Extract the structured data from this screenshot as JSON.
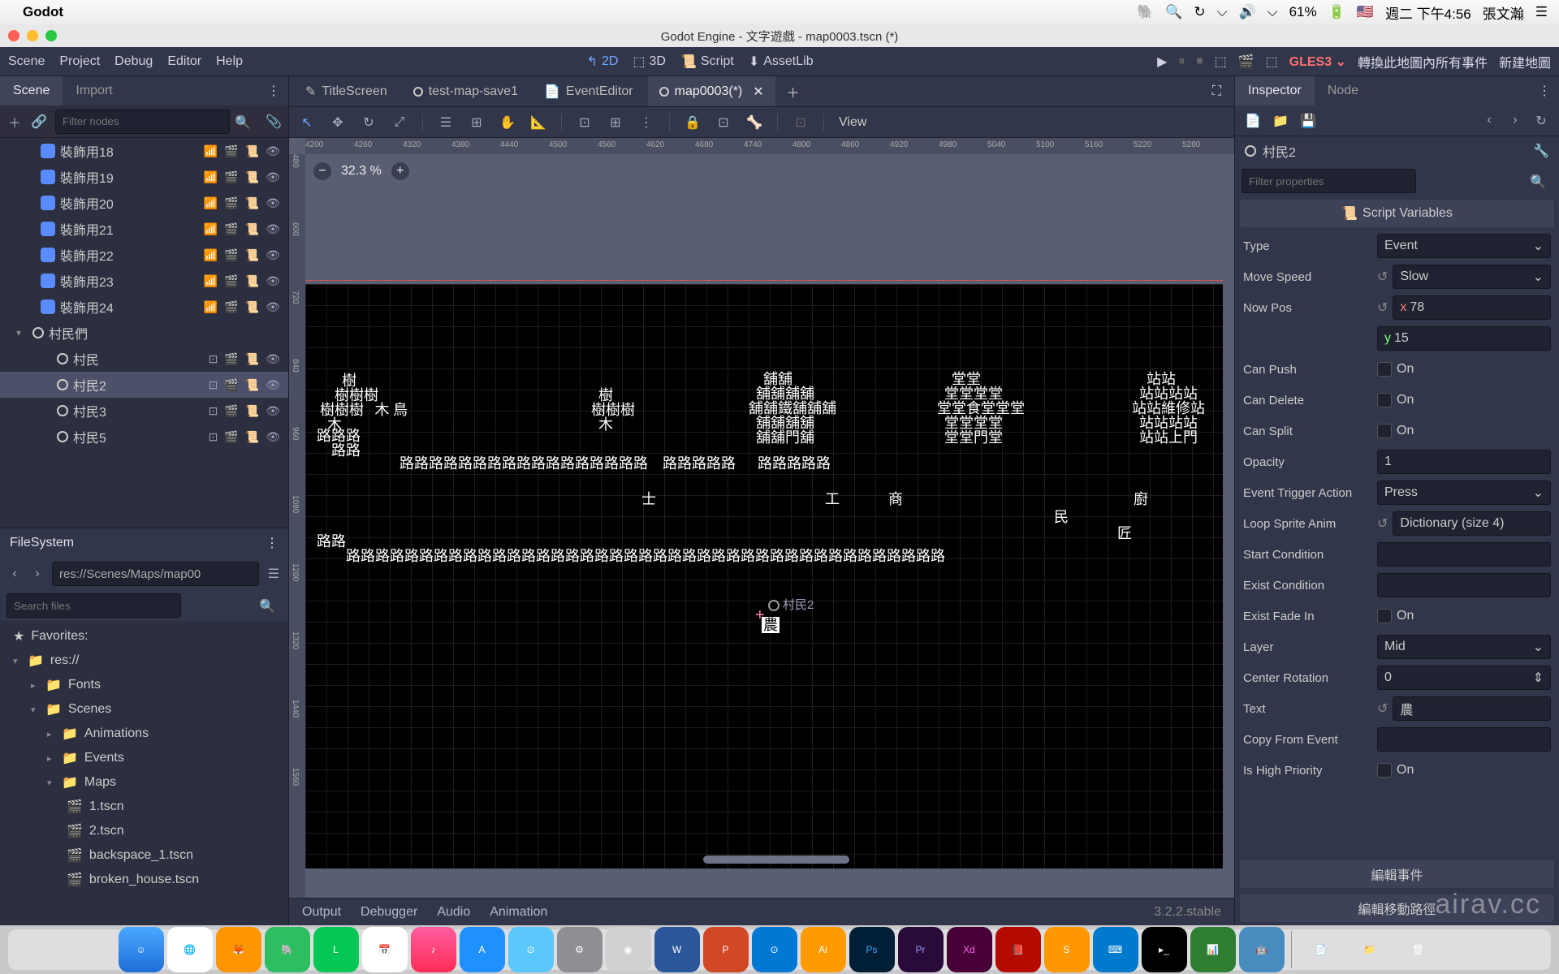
{
  "mac": {
    "app": "Godot",
    "battery": "61%",
    "flag": "🇺🇸",
    "date": "週二 下午4:56",
    "user": "張文瀚"
  },
  "window": {
    "title": "Godot Engine - 文字遊戲 - map0003.tscn (*)"
  },
  "mainmenu": {
    "scene": "Scene",
    "project": "Project",
    "debug": "Debug",
    "editor": "Editor",
    "help": "Help",
    "mode_2d": "2D",
    "mode_3d": "3D",
    "mode_script": "Script",
    "mode_assetlib": "AssetLib",
    "gles3": "GLES3",
    "cn1": "轉換此地圖內所有事件",
    "cn2": "新建地圖"
  },
  "scene_panel": {
    "tab_scene": "Scene",
    "tab_import": "Import",
    "filter_placeholder": "Filter nodes",
    "nodes": [
      {
        "name": "裝飾用18",
        "type": "blue"
      },
      {
        "name": "裝飾用19",
        "type": "blue"
      },
      {
        "name": "裝飾用20",
        "type": "blue"
      },
      {
        "name": "裝飾用21",
        "type": "blue"
      },
      {
        "name": "裝飾用22",
        "type": "blue"
      },
      {
        "name": "裝飾用23",
        "type": "blue"
      },
      {
        "name": "裝飾用24",
        "type": "blue"
      }
    ],
    "parent": "村民們",
    "children": [
      {
        "name": "村民"
      },
      {
        "name": "村民2",
        "selected": true
      },
      {
        "name": "村民3"
      },
      {
        "name": "村民5"
      }
    ]
  },
  "filesystem": {
    "title": "FileSystem",
    "path": "res://Scenes/Maps/map00",
    "search_placeholder": "Search files",
    "favorites": "Favorites:",
    "root": "res://",
    "folders": [
      "Fonts",
      "Scenes"
    ],
    "scenes_children": [
      "Animations",
      "Events",
      "Maps"
    ],
    "maps_files": [
      "1.tscn",
      "2.tscn",
      "backspace_1.tscn",
      "broken_house.tscn"
    ]
  },
  "open_tabs": [
    {
      "icon": "edit",
      "label": "TitleScreen"
    },
    {
      "icon": "circle",
      "label": "test-map-save1"
    },
    {
      "icon": "file",
      "label": "EventEditor"
    },
    {
      "icon": "circle",
      "label": "map0003(*)",
      "active": true,
      "closable": true
    }
  ],
  "viewport": {
    "view_menu": "View",
    "zoom": "32.3 %",
    "ruler_h": [
      "4200",
      "4260",
      "4320",
      "4380",
      "4440",
      "4500",
      "4560",
      "4620",
      "4680",
      "4740",
      "4800",
      "4860",
      "4920",
      "4980",
      "5040",
      "5100",
      "5160",
      "5220",
      "5280"
    ],
    "ruler_v": [
      "480",
      "600",
      "720",
      "840",
      "960",
      "1080",
      "1200",
      "1320",
      "1440",
      "1560"
    ],
    "selected_label": "村民2",
    "selected_char": "農",
    "map_text": {
      "trees1": "      樹\n    樹樹樹\n樹樹樹   木\n  木",
      "trees2": "  樹\n樹樹樹\n  木",
      "bird": "鳥",
      "shop": "    舖舖\n  舖舖舖舖\n舖舖鐵舖舖舖\n  舖舖舖舖\n  舖舖門舖",
      "hall": "    堂堂\n  堂堂堂堂\n堂堂食堂堂堂\n  堂堂堂堂\n  堂堂門堂",
      "station": "    站站\n  站站站站\n站站維修站\n  站站站站\n  站站上門",
      "road1": "路路路\n    路路",
      "road2": "路路路路路路路路路路路路路路路路路    路路路路路      路路路路路",
      "road3": "路路",
      "road4": "路路路路路路路路路路路路路路路路路路路路路路路路路路路路路路路路路路路路路路路路路",
      "shi": "士",
      "gong": "工",
      "shang": "商",
      "min": "民",
      "chu": "廚",
      "jiang": "匠"
    }
  },
  "bottom": {
    "output": "Output",
    "debugger": "Debugger",
    "audio": "Audio",
    "animation": "Animation",
    "version": "3.2.2.stable"
  },
  "inspector": {
    "tab_inspector": "Inspector",
    "tab_node": "Node",
    "node_name": "村民2",
    "filter_placeholder": "Filter properties",
    "section": "Script Variables",
    "props": {
      "type": {
        "label": "Type",
        "value": "Event"
      },
      "move_speed": {
        "label": "Move Speed",
        "value": "Slow"
      },
      "now_pos": {
        "label": "Now Pos",
        "x": "78",
        "y": "15"
      },
      "can_push": {
        "label": "Can Push",
        "value": "On"
      },
      "can_delete": {
        "label": "Can Delete",
        "value": "On"
      },
      "can_split": {
        "label": "Can Split",
        "value": "On"
      },
      "opacity": {
        "label": "Opacity",
        "value": "1"
      },
      "event_trigger": {
        "label": "Event Trigger Action",
        "value": "Press"
      },
      "loop_sprite": {
        "label": "Loop Sprite Anim",
        "value": "Dictionary (size 4)"
      },
      "start_cond": {
        "label": "Start Condition"
      },
      "exist_cond": {
        "label": "Exist Condition"
      },
      "exist_fade": {
        "label": "Exist Fade In",
        "value": "On"
      },
      "layer": {
        "label": "Layer",
        "value": "Mid"
      },
      "center_rot": {
        "label": "Center Rotation",
        "value": "0"
      },
      "text": {
        "label": "Text",
        "value": "農"
      },
      "copy_from": {
        "label": "Copy From Event"
      },
      "high_prio": {
        "label": "Is High Priority",
        "value": "On"
      }
    },
    "btn1": "編輯事件",
    "btn2": "編輯移動路徑"
  },
  "watermark": "airav.cc"
}
